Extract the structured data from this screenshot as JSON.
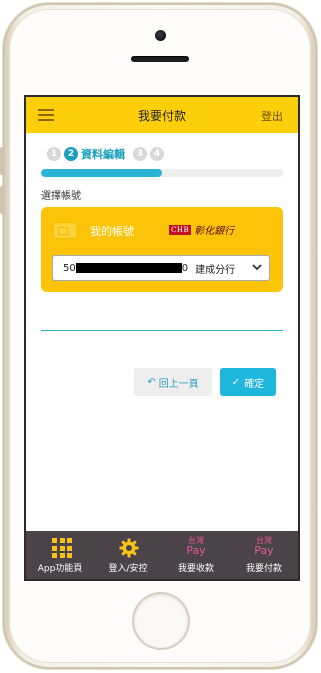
{
  "header": {
    "title": "我要付款",
    "logout": "登出"
  },
  "steps": {
    "step1": "1",
    "step2": "2",
    "step2_label": "資料編輯",
    "step3": "3",
    "step4": "4",
    "progress_fraction": 0.5
  },
  "form": {
    "section_label": "選擇帳號",
    "account_card_label": "我的帳號",
    "bank_badge": "CHB",
    "bank_name": "彰化銀行",
    "account_prefix": "50",
    "account_suffix": "0",
    "account_branch": "建成分行"
  },
  "actions": {
    "back_label": "回上一頁",
    "back_icon": "↶",
    "confirm_label": "確定",
    "confirm_icon": "✓"
  },
  "tabbar": {
    "items": [
      {
        "label": "App功能頁",
        "icon": "grid-icon"
      },
      {
        "label": "登入/安控",
        "icon": "gear-icon"
      },
      {
        "label": "我要收款",
        "icon": "taiwan-pay-icon",
        "icon_top": "台灣",
        "icon_bottom": "Pay"
      },
      {
        "label": "我要付款",
        "icon": "taiwan-pay-icon",
        "icon_top": "台灣",
        "icon_bottom": "Pay"
      }
    ]
  },
  "colors": {
    "accent_yellow": "#fccf0a",
    "accent_blue": "#1eb6dc",
    "tabbar_bg": "#4a4448",
    "pay_pink": "#e45a91"
  }
}
